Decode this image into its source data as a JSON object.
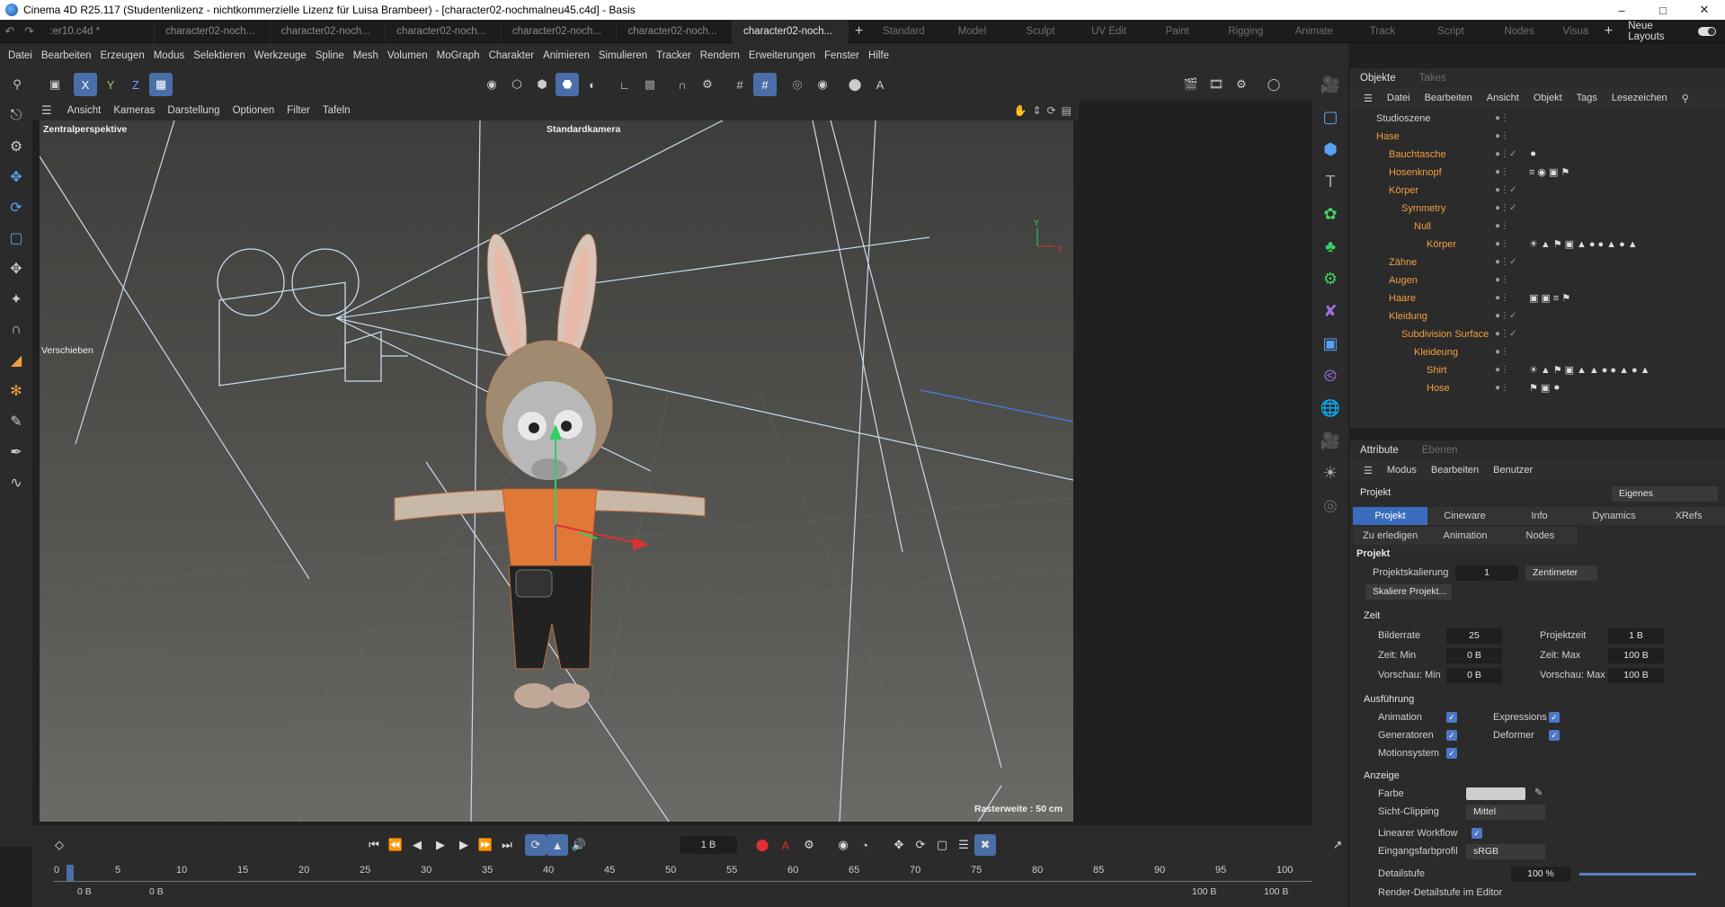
{
  "window": {
    "title": "Cinema 4D R25.117 (Studentenlizenz - nichtkommerzielle Lizenz für Luisa Brambeer) - [character02-nochmalneu45.c4d] - Basis",
    "min_icon": "minimize-icon",
    "max_icon": "maximize-icon",
    "close_icon": "close-icon"
  },
  "doc_tabs": [
    {
      "label": ":er10.c4d *",
      "active": false
    },
    {
      "label": "character02-noch...",
      "active": false
    },
    {
      "label": "character02-noch...",
      "active": false
    },
    {
      "label": "character02-noch...",
      "active": false
    },
    {
      "label": "character02-noch...",
      "active": false
    },
    {
      "label": "character02-noch...",
      "active": false
    },
    {
      "label": "character02-noch...",
      "active": true
    }
  ],
  "workspaces": [
    "Standard",
    "Model",
    "Sculpt",
    "UV Edit",
    "Paint",
    "Rigging",
    "Animate",
    "Track",
    "Script",
    "Nodes",
    "Visua"
  ],
  "layouts_label": "Neue Layouts",
  "menu": [
    "Datei",
    "Bearbeiten",
    "Erzeugen",
    "Modus",
    "Selektieren",
    "Werkzeuge",
    "Spline",
    "Mesh",
    "Volumen",
    "MoGraph",
    "Charakter",
    "Animieren",
    "Simulieren",
    "Tracker",
    "Rendern",
    "Erweiterungen",
    "Fenster",
    "Hilfe"
  ],
  "axis_buttons": [
    "X",
    "Y",
    "Z"
  ],
  "viewport": {
    "menu": [
      "Ansicht",
      "Kameras",
      "Darstellung",
      "Optionen",
      "Filter",
      "Tafeln"
    ],
    "perspective_label": "Zentralperspektive",
    "camera_label": "Standardkamera",
    "tool_label": "Verschieben",
    "grid_label": "Rasterweite : 50 cm",
    "accent": "#5aa0f0"
  },
  "timeline": {
    "current_frame": "1 B",
    "ticks": [
      "0",
      "5",
      "10",
      "15",
      "20",
      "25",
      "30",
      "35",
      "40",
      "45",
      "50",
      "55",
      "60",
      "65",
      "70",
      "75",
      "80",
      "85",
      "90",
      "95",
      "100"
    ],
    "range_start": "0 B",
    "range_start2": "0 B",
    "range_end": "100 B",
    "range_end2": "100 B"
  },
  "objects_panel": {
    "tabs": [
      "Objekte",
      "Takes"
    ],
    "menu": [
      "Datei",
      "Bearbeiten",
      "Ansicht",
      "Objekt",
      "Tags",
      "Lesezeichen"
    ],
    "rows": [
      {
        "name": "Studioszene",
        "indent": 0,
        "color": "#d0d0d0"
      },
      {
        "name": "Hase",
        "indent": 0,
        "color": "#f0a040"
      },
      {
        "name": "Bauchtasche",
        "indent": 1,
        "color": "#f0a040"
      },
      {
        "name": "Hosenknopf",
        "indent": 1,
        "color": "#f0a040"
      },
      {
        "name": "Körper",
        "indent": 1,
        "color": "#f0a040"
      },
      {
        "name": "Symmetry",
        "indent": 2,
        "color": "#f0a040"
      },
      {
        "name": "Null",
        "indent": 3,
        "color": "#f0a040"
      },
      {
        "name": "Körper",
        "indent": 4,
        "color": "#f0a040"
      },
      {
        "name": "Zähne",
        "indent": 1,
        "color": "#f0a040"
      },
      {
        "name": "Augen",
        "indent": 1,
        "color": "#f0a040"
      },
      {
        "name": "Haare",
        "indent": 1,
        "color": "#f0a040"
      },
      {
        "name": "Kleidung",
        "indent": 1,
        "color": "#f0a040"
      },
      {
        "name": "Subdivision Surface",
        "indent": 2,
        "color": "#f0a040"
      },
      {
        "name": "Kleideung",
        "indent": 3,
        "color": "#f0a040"
      },
      {
        "name": "Shirt",
        "indent": 4,
        "color": "#f0a040"
      },
      {
        "name": "Hose",
        "indent": 4,
        "color": "#f0a040"
      }
    ]
  },
  "attributes_panel": {
    "tabs": [
      "Attribute",
      "Ebenen"
    ],
    "menu": [
      "Modus",
      "Bearbeiten",
      "Benutzer"
    ],
    "object_label": "Projekt",
    "mode_dropdown": "Eigenes",
    "tabs_row1": [
      "Projekt",
      "Cineware",
      "Info",
      "Dynamics",
      "XRefs"
    ],
    "tabs_row2": [
      "Zu erledigen",
      "Animation",
      "Nodes"
    ],
    "section_title": "Projekt",
    "projektskalierung_label": "Projektskalierung",
    "projektskalierung_value": "1",
    "unit_value": "Zentimeter",
    "scale_button": "Skaliere Projekt...",
    "zeit_title": "Zeit",
    "bilderrate_label": "Bilderrate",
    "bilderrate_value": "25",
    "projektzeit_label": "Projektzeit",
    "projektzeit_value": "1 B",
    "zeitmin_label": "Zeit: Min",
    "zeitmin_value": "0 B",
    "zeitmax_label": "Zeit: Max",
    "zeitmax_value": "100 B",
    "vormin_label": "Vorschau: Min",
    "vormin_value": "0 B",
    "vormax_label": "Vorschau: Max",
    "vormax_value": "100 B",
    "ausf_title": "Ausführung",
    "animation_label": "Animation",
    "expressions_label": "Expressions",
    "generatoren_label": "Generatoren",
    "deformer_label": "Deformer",
    "motionsystem_label": "Motionsystem",
    "anzeige_title": "Anzeige",
    "farbe_label": "Farbe",
    "sichtclip_label": "Sicht-Clipping",
    "sichtclip_value": "Mittel",
    "linear_label": "Linearer Workflow",
    "eingang_label": "Eingangsfarbprofil",
    "eingang_value": "sRGB",
    "detail_label": "Detailstufe",
    "detail_value": "100 %",
    "render_detail_label": "Render-Detailstufe im Editor"
  }
}
